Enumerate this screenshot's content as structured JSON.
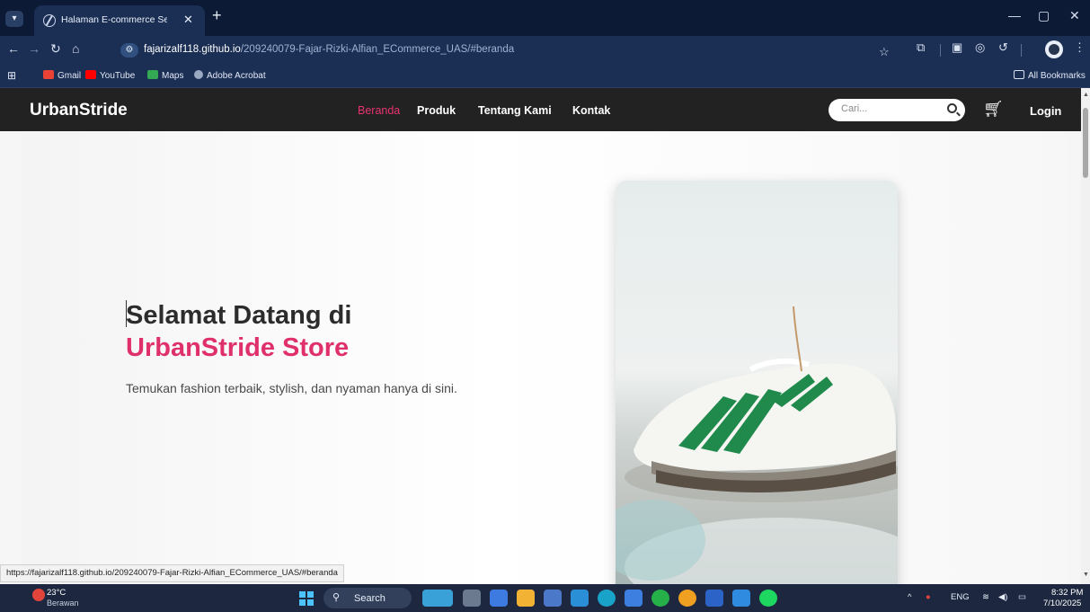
{
  "browser": {
    "tab": {
      "title": "Halaman E-commerce Sederhana",
      "close_glyph": "✕"
    },
    "new_tab_glyph": "+",
    "window_controls": [
      "—",
      "▢",
      "✕"
    ],
    "url_host": "fajarizalf118.github.io",
    "url_path": "/209240079-Fajar-Rizki-Alfian_ECommerce_UAS/#beranda",
    "bookmarks": [
      "Gmail",
      "YouTube",
      "Maps",
      "Adobe Acrobat"
    ],
    "all_bookmarks": "All Bookmarks",
    "status_url": "https://fajarizalf118.github.io/209240079-Fajar-Rizki-Alfian_ECommerce_UAS/#beranda"
  },
  "site": {
    "brand": "UrbanStride",
    "menu": [
      "Beranda",
      "Produk",
      "Tentang Kami",
      "Kontak"
    ],
    "active_menu": "Beranda",
    "search_placeholder": "Cari...",
    "login": "Login",
    "accent_color": "#e0306b",
    "hero": {
      "title_line1": "Selamat Datang di",
      "title_line2": "UrbanStride Store",
      "description": "Temukan fashion terbaik, stylish, dan nyaman hanya di sini."
    }
  },
  "taskbar": {
    "weather_temp": "23°C",
    "weather_desc": "Berawan",
    "search_label": "Search",
    "language": "ENG",
    "time": "8:32 PM",
    "date": "7/10/2025"
  }
}
